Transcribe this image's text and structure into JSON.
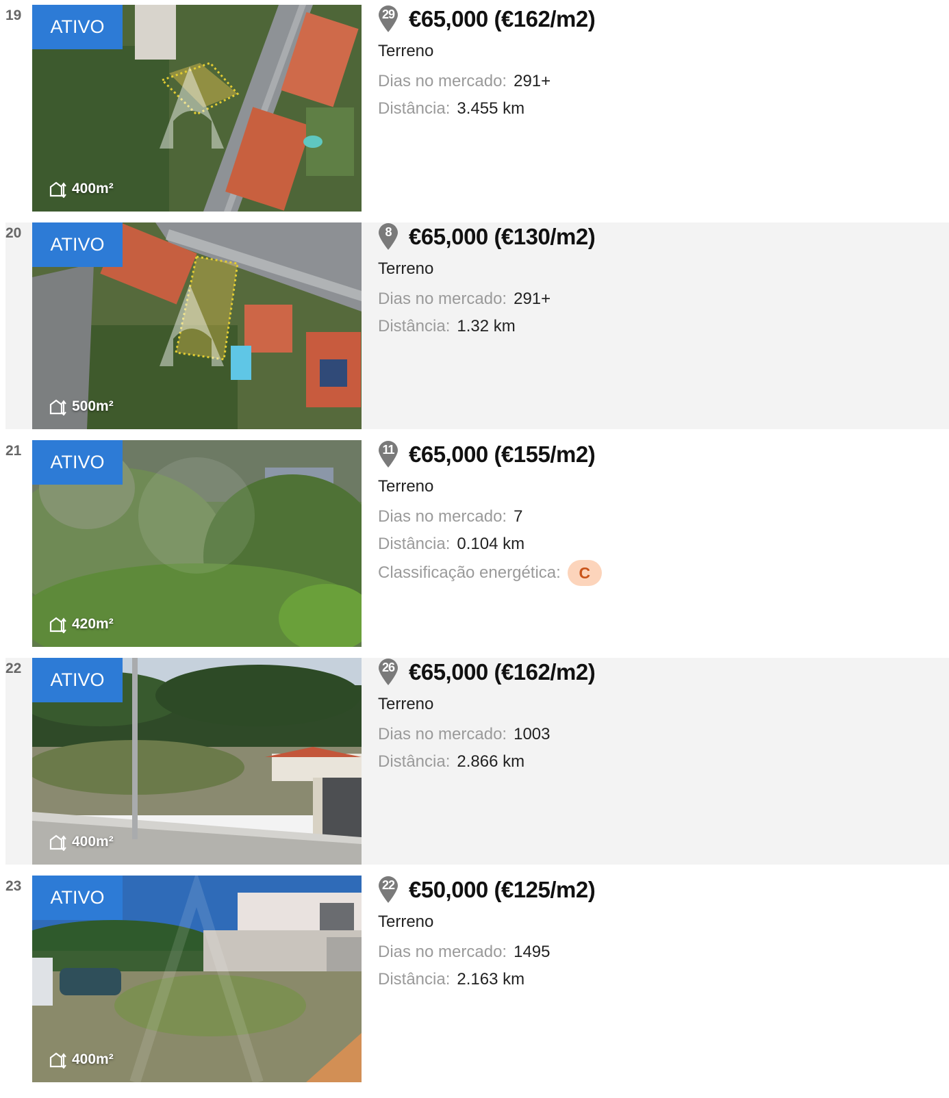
{
  "listings": [
    {
      "rank": "19",
      "status": "ATIVO",
      "area": "400m²",
      "pin": "29",
      "price": "€65,000 (€162/m2)",
      "type": "Terreno",
      "days_label": "Dias no mercado:",
      "days": "291+",
      "dist_label": "Distância:",
      "dist": "3.455 km"
    },
    {
      "rank": "20",
      "status": "ATIVO",
      "area": "500m²",
      "pin": "8",
      "price": "€65,000 (€130/m2)",
      "type": "Terreno",
      "days_label": "Dias no mercado:",
      "days": "291+",
      "dist_label": "Distância:",
      "dist": "1.32 km"
    },
    {
      "rank": "21",
      "status": "ATIVO",
      "area": "420m²",
      "pin": "11",
      "price": "€65,000 (€155/m2)",
      "type": "Terreno",
      "days_label": "Dias no mercado:",
      "days": "7",
      "dist_label": "Distância:",
      "dist": "0.104 km",
      "energy_label": "Classificação energética:",
      "energy": "C"
    },
    {
      "rank": "22",
      "status": "ATIVO",
      "area": "400m²",
      "pin": "26",
      "price": "€65,000 (€162/m2)",
      "type": "Terreno",
      "days_label": "Dias no mercado:",
      "days": "1003",
      "dist_label": "Distância:",
      "dist": "2.866 km"
    },
    {
      "rank": "23",
      "status": "ATIVO",
      "area": "400m²",
      "pin": "22",
      "price": "€50,000 (€125/m2)",
      "type": "Terreno",
      "days_label": "Dias no mercado:",
      "days": "1495",
      "dist_label": "Distância:",
      "dist": "2.163 km"
    }
  ],
  "colors": {
    "badge": "#2d7bd6",
    "pin": "#7a7a7a",
    "energy_bg": "#fcd4bb",
    "energy_text": "#c9541a",
    "row_shade": "#f3f3f3"
  },
  "icons": {
    "area": "area-icon",
    "pin": "map-pin-icon"
  }
}
